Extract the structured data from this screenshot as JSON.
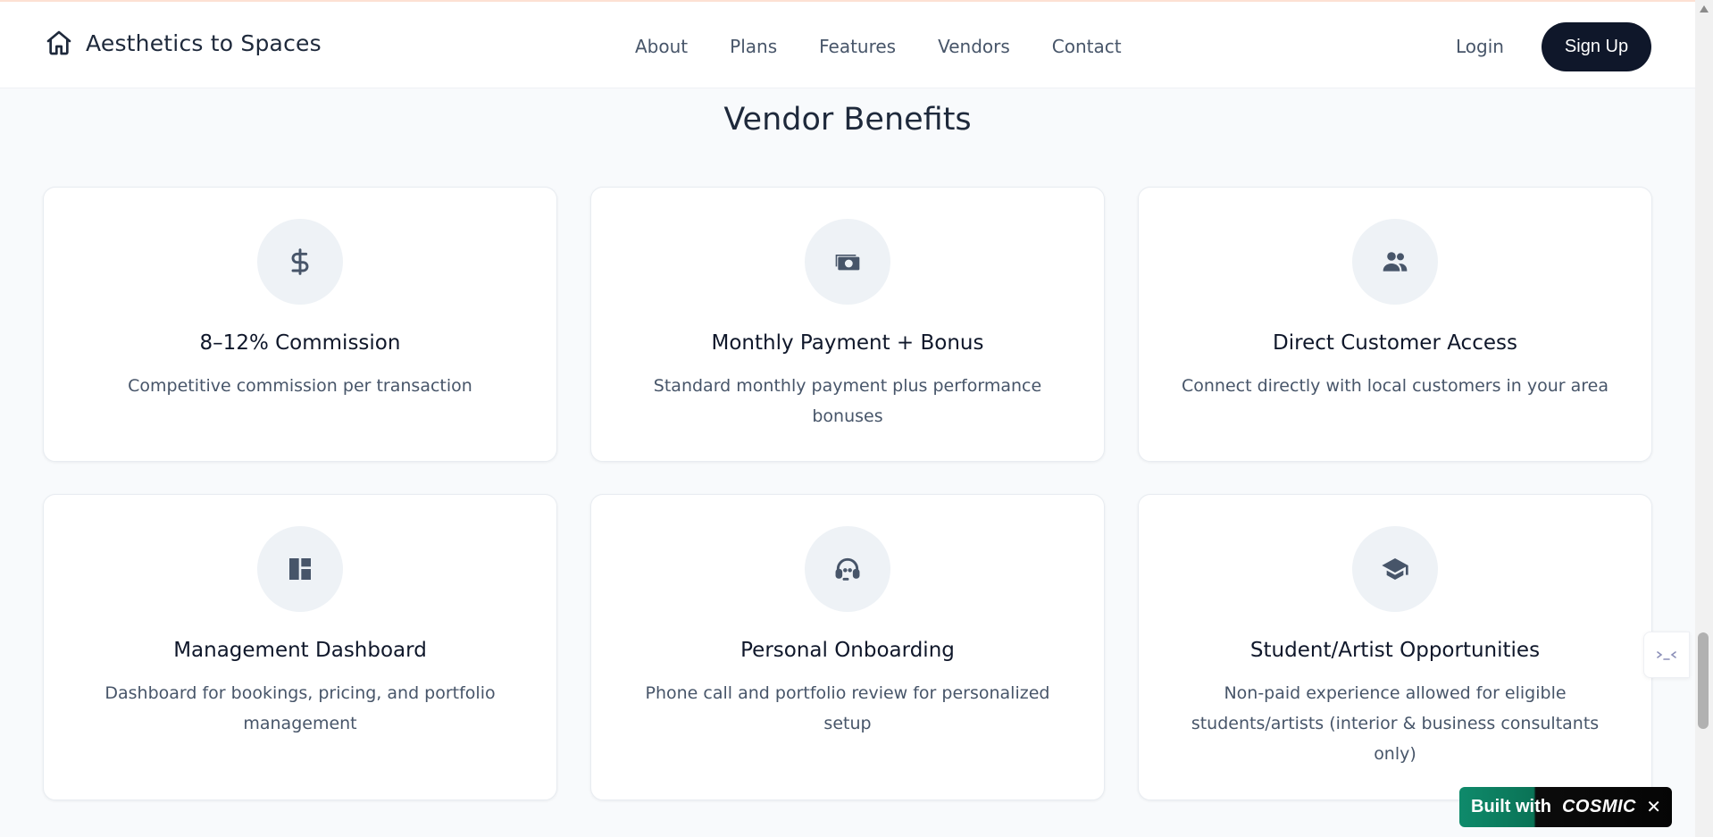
{
  "header": {
    "brand": "Aesthetics to Spaces",
    "nav": [
      "About",
      "Plans",
      "Features",
      "Vendors",
      "Contact"
    ],
    "login_label": "Login",
    "signup_label": "Sign Up"
  },
  "section": {
    "title": "Vendor Benefits",
    "cards": [
      {
        "icon": "dollar-icon",
        "title": "8–12% Commission",
        "description": "Competitive commission per transaction"
      },
      {
        "icon": "money-icon",
        "title": "Monthly Payment + Bonus",
        "description": "Standard monthly payment plus performance bonuses"
      },
      {
        "icon": "people-icon",
        "title": "Direct Customer Access",
        "description": "Connect directly with local customers in your area"
      },
      {
        "icon": "dashboard-icon",
        "title": "Management Dashboard",
        "description": "Dashboard for bookings, pricing, and portfolio management"
      },
      {
        "icon": "headset-icon",
        "title": "Personal Onboarding",
        "description": "Phone call and portfolio review for personalized setup"
      },
      {
        "icon": "graduation-cap-icon",
        "title": "Student/Artist Opportunities",
        "description": "Non-paid experience allowed for eligible students/artists (interior & business consultants only)"
      }
    ]
  },
  "badge": {
    "prefix": "Built with",
    "brand": "COSMIC",
    "close": "✕"
  },
  "colors": {
    "primary": "#0f172a",
    "text_muted": "#475569",
    "icon_bg": "#eef2f6",
    "badge_green": "#0f8a6b"
  }
}
